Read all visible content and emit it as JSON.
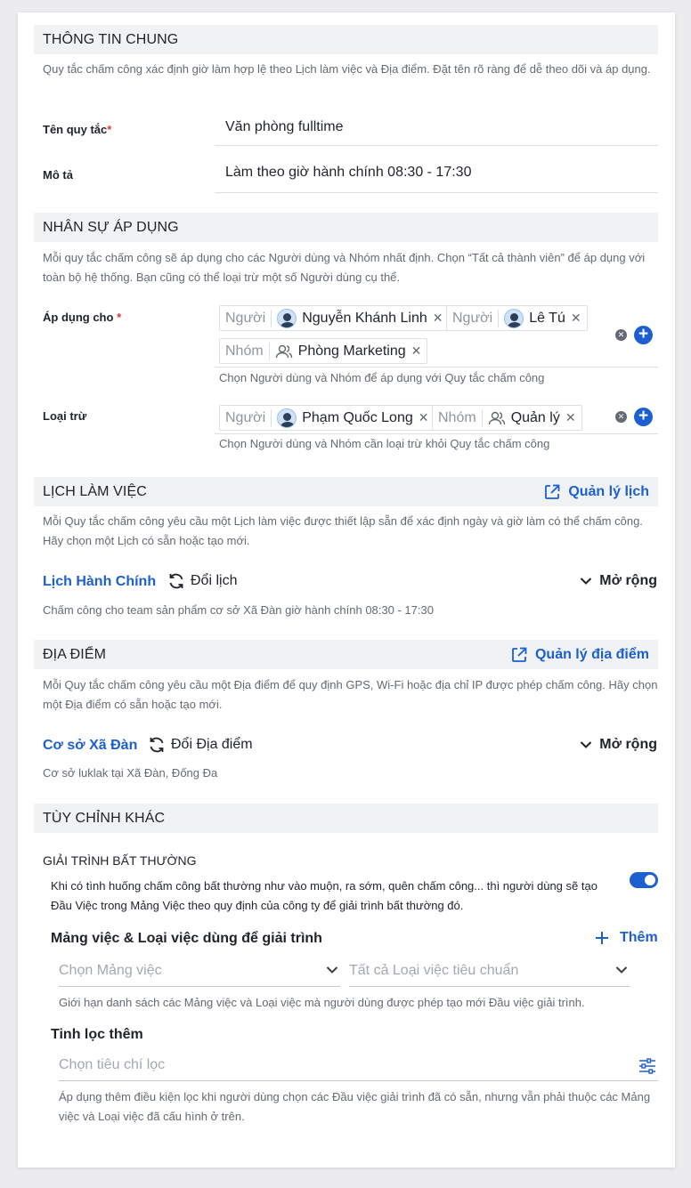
{
  "general": {
    "title": "THÔNG TIN CHUNG",
    "desc": "Quy tắc chấm công xác định giờ làm hợp lệ theo Lịch làm việc và Địa điểm. Đặt tên rõ ràng để dễ theo dõi và áp dụng.",
    "name_label": "Tên quy tắc",
    "required_mark": "*",
    "name_value": "Văn phòng fulltime",
    "desc_label": "Mô tả",
    "desc_value": "Làm theo giờ hành chính 08:30 - 17:30"
  },
  "staff": {
    "title": "NHÂN SỰ ÁP DỤNG",
    "desc": "Mỗi quy tắc chấm công sẽ áp dụng cho các Người dùng và Nhóm nhất định. Chọn “Tất cả thành viên” để áp dụng với toàn bộ hệ thống. Bạn cũng có thể loại trừ một số Người dùng cụ thể.",
    "apply_label": "Áp dụng cho",
    "required_mark": "*",
    "apply_chips": [
      {
        "kind": "Người",
        "name": "Nguyễn Khánh Linh",
        "icon": "avatar"
      },
      {
        "kind": "Người",
        "name": "Lê Tú",
        "icon": "avatar"
      },
      {
        "kind": "Nhóm",
        "name": "Phòng Marketing",
        "icon": "group-icon"
      }
    ],
    "apply_hint": "Chọn Người dùng và Nhóm để áp dụng với Quy tắc chấm công",
    "exclude_label": "Loại trừ",
    "exclude_chips": [
      {
        "kind": "Người",
        "name": "Phạm Quốc Long",
        "icon": "avatar"
      },
      {
        "kind": "Nhóm",
        "name": "Quản lý",
        "icon": "group-icon"
      }
    ],
    "exclude_hint": "Chọn Người dùng và Nhóm cần loại trừ khỏi Quy tắc chấm công",
    "clear_glyph": "✕",
    "add_glyph": "+"
  },
  "schedule": {
    "title": "LỊCH LÀM VIỆC",
    "link": "Quản lý lịch",
    "desc": "Mỗi Quy tắc chấm công yêu cầu một Lịch làm việc được thiết lập sẵn để xác định ngày và giờ làm có thể chấm công. Hãy chọn một Lịch có sẵn hoặc tạo mới.",
    "selected": "Lịch Hành Chính",
    "change": "Đổi lịch",
    "expand": "Mở rộng",
    "note": "Chấm công cho team sản phẩm cơ sở Xã Đàn giờ hành chính 08:30 - 17:30"
  },
  "location": {
    "title": "ĐỊA ĐIỂM",
    "link": "Quản lý địa điểm",
    "desc": "Mỗi Quy tắc chấm công yêu cầu một Địa điểm để quy định GPS, Wi-Fi hoặc địa chỉ IP được phép chấm công. Hãy chọn một Địa điểm có sẵn hoặc tạo mới.",
    "selected": "Cơ sở Xã Đàn",
    "change": "Đổi Địa điểm",
    "expand": "Mở rộng",
    "note": "Cơ sở luklak tại Xã Đàn, Đống Đa"
  },
  "custom": {
    "title": "TÙY CHỈNH KHÁC",
    "anomaly_title": "GIẢI TRÌNH BẤT THƯỜNG",
    "anomaly_desc": "Khi có tình huống chấm công bất thường như vào muộn, ra sớm, quên chấm công... thì người dùng sẽ tạo Đầu Việc trong Mảng Việc theo quy định của công ty để giải trình bất thường đó.",
    "anomaly_enabled": true,
    "work_title": "Mảng việc & Loại việc dùng để giải trình",
    "add_label": "Thêm",
    "area_placeholder": "Chọn Mảng việc",
    "type_placeholder": "Tất cả Loại việc tiêu chuẩn",
    "work_hint": "Giới hạn danh sách các Mảng việc và Loại việc mà người dùng được phép tạo mới Đầu việc giải trình.",
    "filter_title": "Tinh lọc thêm",
    "filter_placeholder": "Chọn tiêu chí lọc",
    "filter_desc": "Áp dụng thêm điều kiện lọc khi người dùng chọn các Đầu việc giải trình đã có sẵn, nhưng vẫn phải thuộc các Mảng việc và Loại việc đã cấu hình ở trên."
  },
  "colors": {
    "accent": "#1b5fd1",
    "section_bg": "#f1f2f4",
    "required": "#e53935"
  }
}
